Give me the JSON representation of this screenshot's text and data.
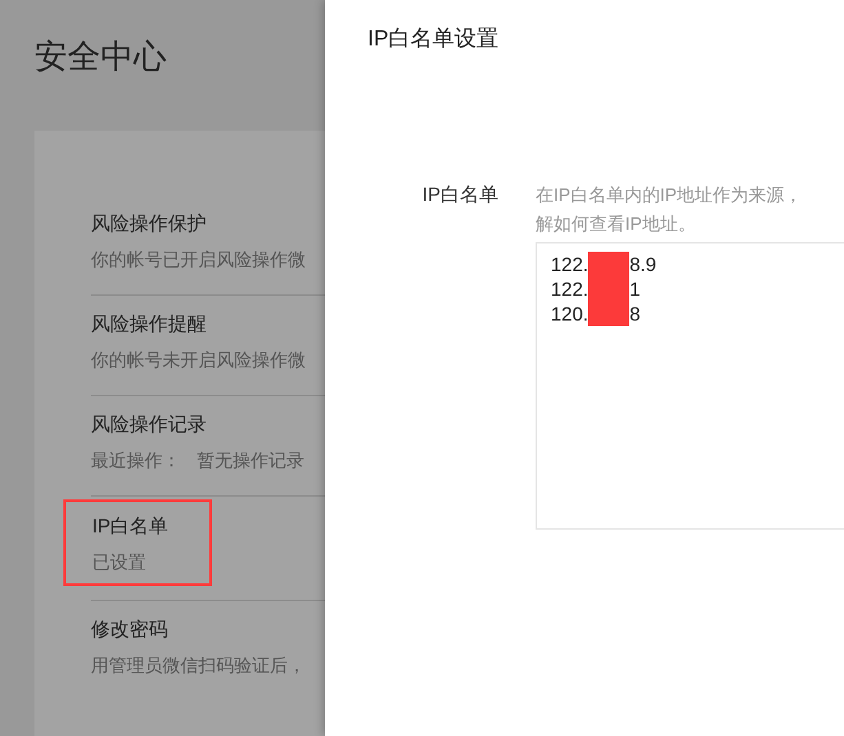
{
  "page": {
    "title": "安全中心"
  },
  "items": [
    {
      "title": "风险操作保护",
      "desc": [
        "你的帐号已开启风险操作微"
      ],
      "highlighted": false
    },
    {
      "title": "风险操作提醒",
      "desc": [
        "你的帐号未开启风险操作微"
      ],
      "highlighted": false
    },
    {
      "title": "风险操作记录",
      "desc": [
        "最近操作：",
        "暂无操作记录"
      ],
      "highlighted": false
    },
    {
      "title": "IP白名单",
      "desc": [
        "已设置"
      ],
      "highlighted": true
    },
    {
      "title": "修改密码",
      "desc": [
        "用管理员微信扫码验证后，"
      ],
      "highlighted": false
    }
  ],
  "drawer": {
    "title": "IP白名单设置",
    "field_label": "IP白名单",
    "help_lines": [
      "在IP白名单内的IP地址作为来源，",
      "解如何查看IP地址。"
    ],
    "ip_lines": [
      {
        "start": "122.",
        "end": "8.9",
        "redacted": true
      },
      {
        "start": "122.",
        "end": "1",
        "redacted": true
      },
      {
        "start": "120.",
        "end": "8",
        "redacted": true
      }
    ]
  }
}
